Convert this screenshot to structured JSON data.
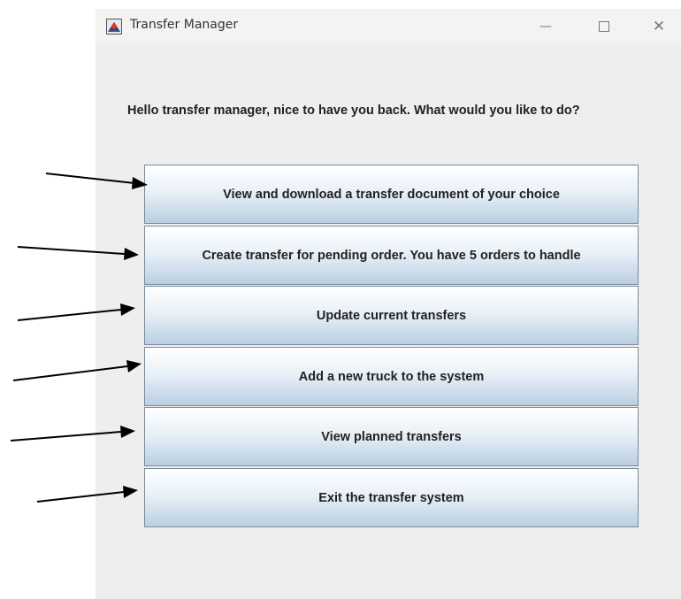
{
  "window": {
    "title": "Transfer Manager",
    "controls": {
      "minimize": "—",
      "close": "✕"
    }
  },
  "greeting": "Hello transfer manager, nice to have you back. What would you like to do?",
  "menu": {
    "buttons": [
      {
        "label": "View and download a transfer document of your choice"
      },
      {
        "label": "Create transfer for pending order. You have 5 orders to handle"
      },
      {
        "label": "Update current transfers"
      },
      {
        "label": "Add a new truck to the system"
      },
      {
        "label": "View planned transfers"
      },
      {
        "label": "Exit the transfer system"
      }
    ]
  },
  "icons": {
    "app": "java-app-icon",
    "minimize": "minimize-icon",
    "maximize": "maximize-icon",
    "close": "close-icon",
    "annotation": "arrow-icon"
  },
  "colors": {
    "window_bg": "#eeeeee",
    "button_top": "#ffffff",
    "button_bottom": "#b9cfe2",
    "button_border": "#7a8a99"
  }
}
